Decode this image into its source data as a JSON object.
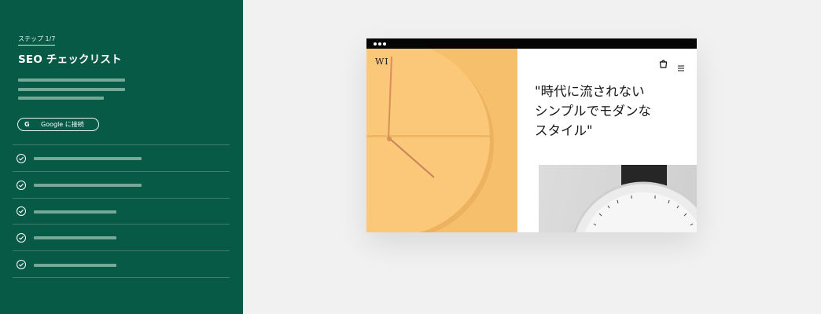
{
  "panel": {
    "step_label": "ステップ 1/7",
    "title": "SEO チェックリスト",
    "google_button": {
      "logo": "G",
      "label": "Google に接続"
    },
    "checklist": [
      {
        "icon": "check-circle-icon",
        "status": "done"
      },
      {
        "icon": "check-circle-icon",
        "status": "done"
      },
      {
        "icon": "check-circle-icon",
        "status": "done"
      },
      {
        "icon": "check-circle-icon",
        "status": "done"
      },
      {
        "icon": "check-circle-icon",
        "status": "done"
      }
    ]
  },
  "mockup": {
    "logo": "WI",
    "quote": "\"時代に流されない\nシンプルでモダンな\nスタイル\"",
    "icons": [
      "shopping-bag-icon",
      "hamburger-menu-icon"
    ]
  },
  "colors": {
    "panel_bg": "#075a46",
    "page_bg": "#f1f1f1",
    "clock_yellow": "#f6bf6c",
    "placeholder_bar": "#76a898"
  }
}
